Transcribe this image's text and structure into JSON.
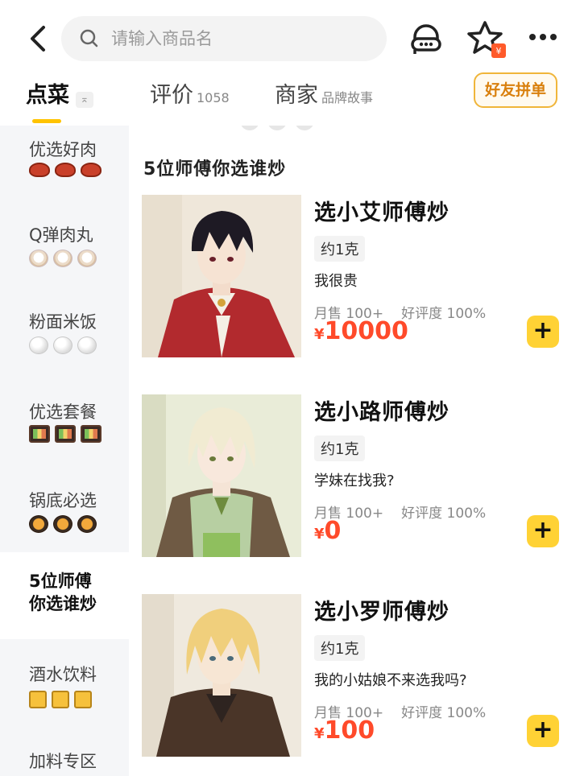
{
  "search": {
    "placeholder": "请输入商品名"
  },
  "tabs": {
    "menu": {
      "label": "点菜",
      "collapse_icon": "⌅"
    },
    "reviews": {
      "label": "评价",
      "count": "1058"
    },
    "store": {
      "label": "商家",
      "sub": "品牌故事"
    },
    "group_order": "好友拼单"
  },
  "sidebar": {
    "items": [
      {
        "label": "优选好肉",
        "icon": "steak-icon"
      },
      {
        "label": "Q弹肉丸",
        "icon": "meatball-icon"
      },
      {
        "label": "粉面米饭",
        "icon": "rice-icon"
      },
      {
        "label": "优选套餐",
        "icon": "bento-icon"
      },
      {
        "label": "锅底必选",
        "icon": "hotpot-icon"
      },
      {
        "label_line1": "5位师傅",
        "label_line2": "你选谁炒",
        "active": true
      },
      {
        "label": "酒水饮料",
        "icon": "beer-icon"
      },
      {
        "label": "加料专区",
        "icon": "topping-icon"
      }
    ]
  },
  "section": {
    "title": "5位师傅你选谁炒"
  },
  "items": [
    {
      "name": "选小艾师傅炒",
      "tag": "约1克",
      "desc": "我很贵",
      "sales": "月售 100+",
      "rating": "好评度 100%",
      "currency": "¥",
      "price": "10000"
    },
    {
      "name": "选小路师傅炒",
      "tag": "约1克",
      "desc": "学妹在找我?",
      "sales": "月售 100+",
      "rating": "好评度 100%",
      "currency": "¥",
      "price": "0"
    },
    {
      "name": "选小罗师傅炒",
      "tag": "约1克",
      "desc": "我的小姑娘不来选我吗?",
      "sales": "月售 100+",
      "rating": "好评度 100%",
      "currency": "¥",
      "price": "100"
    }
  ],
  "colors": {
    "accent": "#ffd235",
    "price": "#ff4a2a",
    "group_border": "#f0b53a"
  }
}
